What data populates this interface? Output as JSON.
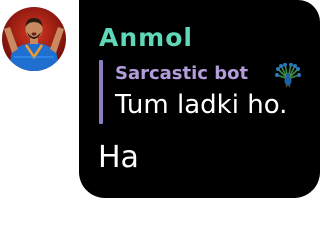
{
  "message": {
    "avatar": {
      "icon": "user-avatar-photo"
    },
    "sender_name": "Anmol",
    "sender_name_color": "#5fd8b9",
    "bubble_color": "#000000",
    "reply": {
      "author": "Sarcastic bot",
      "author_color": "#b39ddb",
      "author_emoji": "peacock",
      "bar_color": "#8e7cc3",
      "text": "Tum ladki ho."
    },
    "text": "Ha"
  }
}
